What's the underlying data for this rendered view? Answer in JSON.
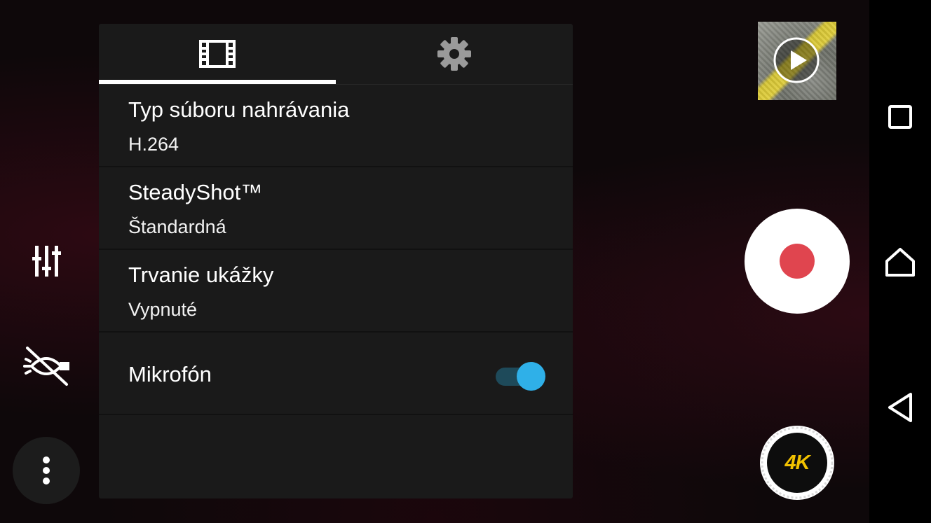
{
  "tabs": [
    {
      "name": "video-settings",
      "icon": "film-strip-icon",
      "selected": true
    },
    {
      "name": "general-settings",
      "icon": "gear-icon",
      "selected": false
    }
  ],
  "settings": [
    {
      "title": "Typ súboru nahrávania",
      "value": "H.264"
    },
    {
      "title": "SteadyShot™",
      "value": "Štandardná"
    },
    {
      "title": "Trvanie ukážky",
      "value": "Vypnuté"
    }
  ],
  "microphone": {
    "title": "Mikrofón",
    "enabled": true
  },
  "record_mode_label": "4K",
  "colors": {
    "accent": "#2fb0e8",
    "record": "#e0454f",
    "mode_badge": "#f2c200",
    "panel": "#1a1a1a"
  },
  "icons": {
    "left": [
      "sliders-icon",
      "flash-off-icon",
      "more-vertical-icon"
    ],
    "right": [
      "play-icon",
      "record-icon"
    ],
    "nav": [
      "recents-icon",
      "home-icon",
      "back-icon"
    ]
  }
}
